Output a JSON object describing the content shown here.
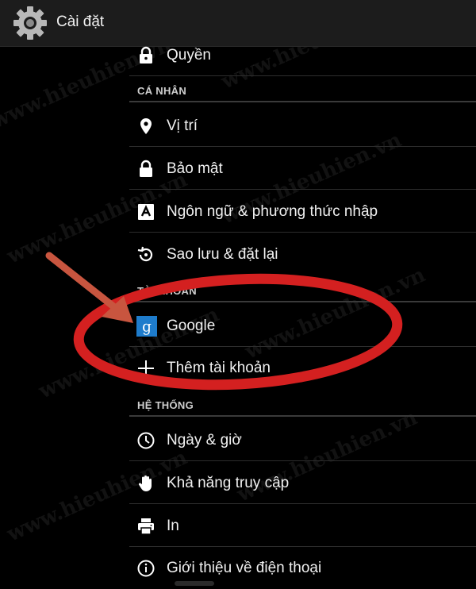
{
  "header": {
    "title": "Cài đặt",
    "icon": "gear-icon"
  },
  "rows": [
    {
      "label": "Quyền",
      "icon": "lock-icon"
    },
    {
      "label": "Vị trí",
      "icon": "location-pin-icon"
    },
    {
      "label": "Bảo mật",
      "icon": "lock-icon"
    },
    {
      "label": "Ngôn ngữ & phương thức nhập",
      "icon": "language-keyboard-icon"
    },
    {
      "label": "Sao lưu & đặt lại",
      "icon": "backup-restore-icon"
    },
    {
      "label": "Google",
      "icon": "google-icon"
    },
    {
      "label": "Thêm tài khoản",
      "icon": "add-icon"
    },
    {
      "label": "Ngày & giờ",
      "icon": "clock-icon"
    },
    {
      "label": "Khả năng truy cập",
      "icon": "hand-icon"
    },
    {
      "label": "In",
      "icon": "printer-icon"
    },
    {
      "label": "Giới thiệu về điện thoại",
      "icon": "info-icon"
    }
  ],
  "sections": {
    "personal": "CÁ NHÂN",
    "accounts": "TÀI KHOẢN",
    "system": "HỆ THỐNG"
  },
  "watermark": "www.hieuhien.vn",
  "colors": {
    "background": "#000000",
    "topbar": "#1c1c1c",
    "annotation_red": "#d42020",
    "arrow": "#c8553f",
    "google_blue": "#1e7ccc"
  }
}
